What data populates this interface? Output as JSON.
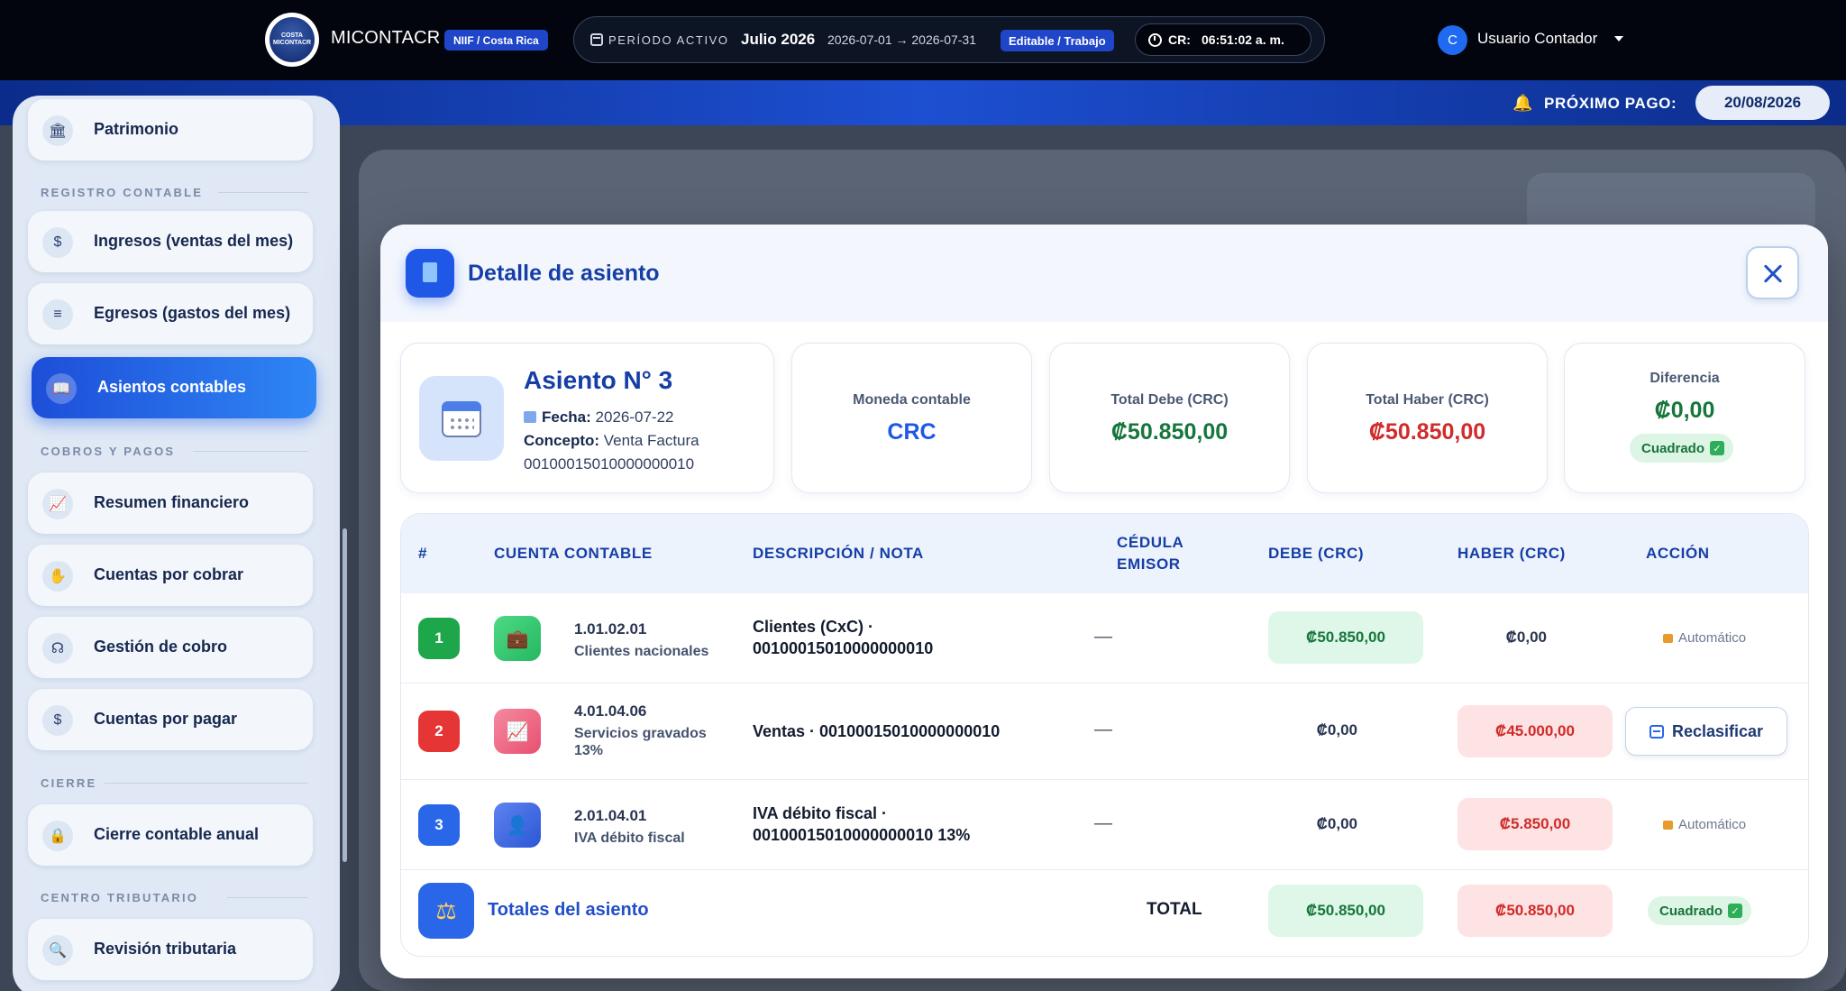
{
  "topbar": {
    "logo_text": "COSTA MICONTACR",
    "app_name": "MICONTACR",
    "niif_badge": "NIIF / Costa Rica",
    "period_label": "PERÍODO ACTIVO",
    "period_month": "Julio 2026",
    "period_range": "2026-07-01 → 2026-07-31",
    "period_mode": "Editable / Trabajo",
    "clock_prefix": "CR:",
    "clock_time": "06:51:02 a. m.",
    "user_initial": "C",
    "user_name": "Usuario Contador"
  },
  "payment": {
    "label": "PRÓXIMO PAGO:",
    "date": "20/08/2026"
  },
  "sidebar": {
    "items": [
      {
        "label": "Patrimonio",
        "icon": "bank-icon"
      },
      {
        "label": "Ingresos (ventas del mes)",
        "icon": "invoice-dollar-icon"
      },
      {
        "label": "Egresos (gastos del mes)",
        "icon": "receipt-icon"
      },
      {
        "label": "Asientos contables",
        "icon": "open-book-icon"
      },
      {
        "label": "Resumen financiero",
        "icon": "line-chart-icon"
      },
      {
        "label": "Cuentas por cobrar",
        "icon": "hand-coin-icon"
      },
      {
        "label": "Gestión de cobro",
        "icon": "headset-icon"
      },
      {
        "label": "Cuentas por pagar",
        "icon": "invoice-dollar-icon"
      },
      {
        "label": "Cierre contable anual",
        "icon": "lock-icon"
      },
      {
        "label": "Revisión tributaria",
        "icon": "search-document-icon"
      }
    ],
    "sections": {
      "registro": "REGISTRO CONTABLE",
      "cobros": "COBROS Y PAGOS",
      "cierre": "CIERRE",
      "tributario": "CENTRO TRIBUTARIO"
    },
    "active_item": "Asientos contables"
  },
  "modal": {
    "title": "Detalle de asiento",
    "asiento": {
      "title": "Asiento N° 3",
      "fecha_label": "Fecha:",
      "fecha_value": "2026-07-22",
      "concepto_label": "Concepto:",
      "concepto_value": "Venta Factura",
      "concepto_number": "00100015010000000010"
    },
    "stats": {
      "moneda_label": "Moneda contable",
      "moneda_value": "CRC",
      "debe_label": "Total Debe (CRC)",
      "debe_value": "₡50.850,00",
      "haber_label": "Total Haber (CRC)",
      "haber_value": "₡50.850,00",
      "diferencia_label": "Diferencia",
      "diferencia_value": "₡0,00",
      "status": "Cuadrado"
    },
    "table": {
      "headers": {
        "num": "#",
        "cuenta": "CUENTA CONTABLE",
        "descripcion": "DESCRIPCIÓN / NOTA",
        "cedula_1": "CÉDULA",
        "cedula_2": "EMISOR",
        "debe": "DEBE (CRC)",
        "haber": "HABER (CRC)",
        "accion": "ACCIÓN"
      },
      "rows": [
        {
          "num": "1",
          "code": "1.01.02.01",
          "name_1": "Clientes nacionales",
          "name_2": "",
          "desc_1": "Clientes (CxC) ·",
          "desc_2": "00100015010000000010",
          "cedula": "—",
          "debe": "₡50.850,00",
          "haber": "₡0,00",
          "action": "Automático"
        },
        {
          "num": "2",
          "code": "4.01.04.06",
          "name_1": "Servicios gravados",
          "name_2": "13%",
          "desc_1": "Ventas · 00100015010000000010",
          "desc_2": "",
          "cedula": "—",
          "debe": "₡0,00",
          "haber": "₡45.000,00",
          "action": "Reclasificar"
        },
        {
          "num": "3",
          "code": "2.01.04.01",
          "name_1": "IVA débito fiscal",
          "name_2": "",
          "desc_1": "IVA débito fiscal ·",
          "desc_2": "00100015010000000010 13%",
          "cedula": "—",
          "debe": "₡0,00",
          "haber": "₡5.850,00",
          "action": "Automático"
        }
      ],
      "totals": {
        "label": "Totales del asiento",
        "word": "TOTAL",
        "debe": "₡50.850,00",
        "haber": "₡50.850,00",
        "status": "Cuadrado"
      }
    }
  },
  "colors": {
    "brand_blue": "#1f57e7",
    "debit_green": "#17763c",
    "credit_red": "#d12b2b",
    "topbar_bg": "#02050d"
  }
}
